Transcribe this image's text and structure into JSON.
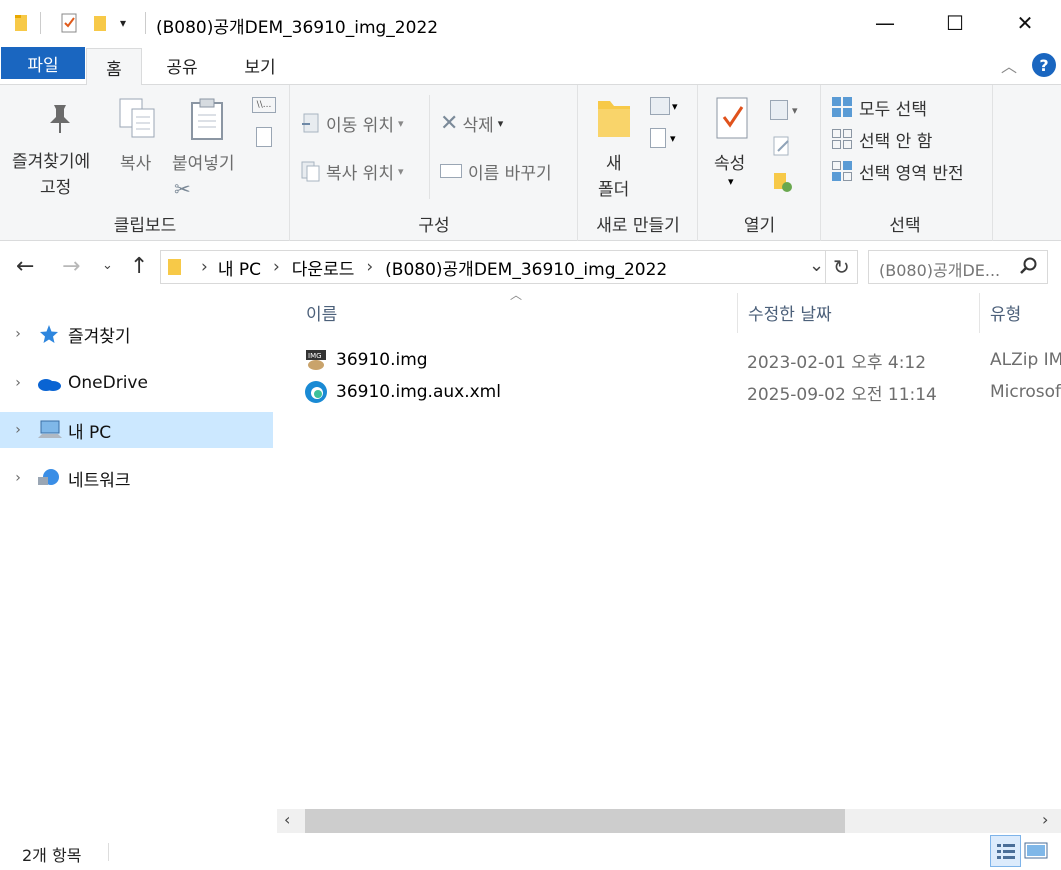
{
  "window": {
    "title": "(B080)공개DEM_36910_img_2022",
    "minimize_glyph": "—",
    "maximize_glyph": "☐",
    "close_glyph": "✕"
  },
  "tabs": [
    {
      "label": "파일"
    },
    {
      "label": "홈"
    },
    {
      "label": "공유"
    },
    {
      "label": "보기"
    }
  ],
  "ribbon": {
    "clipboard": {
      "pin_label_1": "즐겨찾기에",
      "pin_label_2": "고정",
      "copy_label": "복사",
      "paste_label": "붙여넣기",
      "group_label": "클립보드"
    },
    "organize": {
      "move_to": "이동 위치",
      "copy_to": "복사 위치",
      "delete": "삭제",
      "rename": "이름 바꾸기",
      "group_label": "구성"
    },
    "new": {
      "new_folder_1": "새",
      "new_folder_2": "폴더",
      "group_label": "새로 만들기"
    },
    "open": {
      "properties": "속성",
      "group_label": "열기"
    },
    "select": {
      "select_all": "모두 선택",
      "select_none": "선택 안 함",
      "invert": "선택 영역 반전",
      "group_label": "선택"
    }
  },
  "address": {
    "crumbs": [
      "내 PC",
      "다운로드",
      "(B080)공개DEM_36910_img_2022"
    ],
    "search_placeholder": "(B080)공개DE..."
  },
  "nav": {
    "items": [
      {
        "label": "즐겨찾기"
      },
      {
        "label": "OneDrive"
      },
      {
        "label": "내 PC"
      },
      {
        "label": "네트워크"
      }
    ]
  },
  "files": {
    "columns": [
      "이름",
      "수정한 날짜",
      "유형"
    ],
    "rows": [
      {
        "name": "36910.img",
        "date": "2023-02-01 오후 4:12",
        "type": "ALZip IM"
      },
      {
        "name": "36910.img.aux.xml",
        "date": "2025-09-02 오전 11:14",
        "type": "Microsof"
      }
    ]
  },
  "status": {
    "count": "2개 항목"
  },
  "colors": {
    "file_tab": "#1a66c0",
    "selected_nav": "#cce8ff",
    "ribbon_bg": "#f5f6f7",
    "help_blue": "#1a66c0"
  }
}
